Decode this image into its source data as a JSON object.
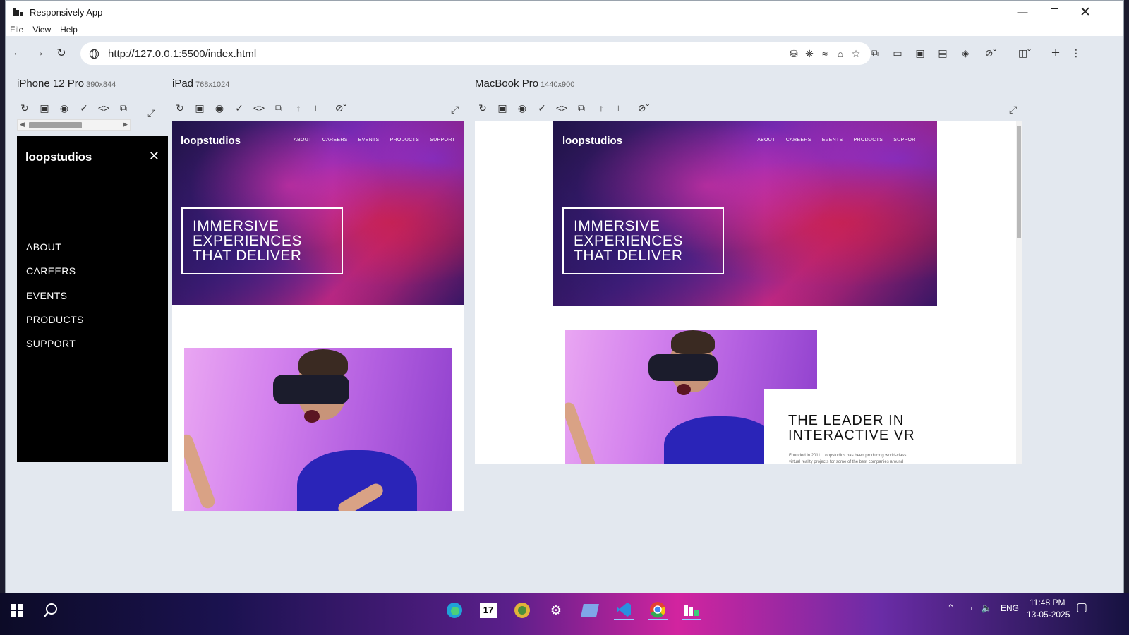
{
  "window": {
    "title": "Responsively App"
  },
  "menu": [
    "File",
    "View",
    "Help"
  ],
  "address": {
    "url": "http://127.0.0.1:5500/index.html"
  },
  "devices": [
    {
      "name": "iPhone 12 Pro",
      "size": "390x844"
    },
    {
      "name": "iPad",
      "size": "768x1024"
    },
    {
      "name": "MacBook Pro",
      "size": "1440x900"
    }
  ],
  "site": {
    "brand": "loopstudios",
    "nav": [
      "ABOUT",
      "CAREERS",
      "EVENTS",
      "PRODUCTS",
      "SUPPORT"
    ],
    "hero": [
      "IMMERSIVE",
      "EXPERIENCES",
      "THAT DELIVER"
    ],
    "leader_title": [
      "THE LEADER IN",
      "INTERACTIVE VR"
    ],
    "leader_text": "Founded in 2011, Loopstudios has been producing world-class virtual reality projects for some of the best companies around"
  },
  "taskbar": {
    "language": "ENG",
    "time": "11:48 PM",
    "date": "13-05-2025"
  }
}
